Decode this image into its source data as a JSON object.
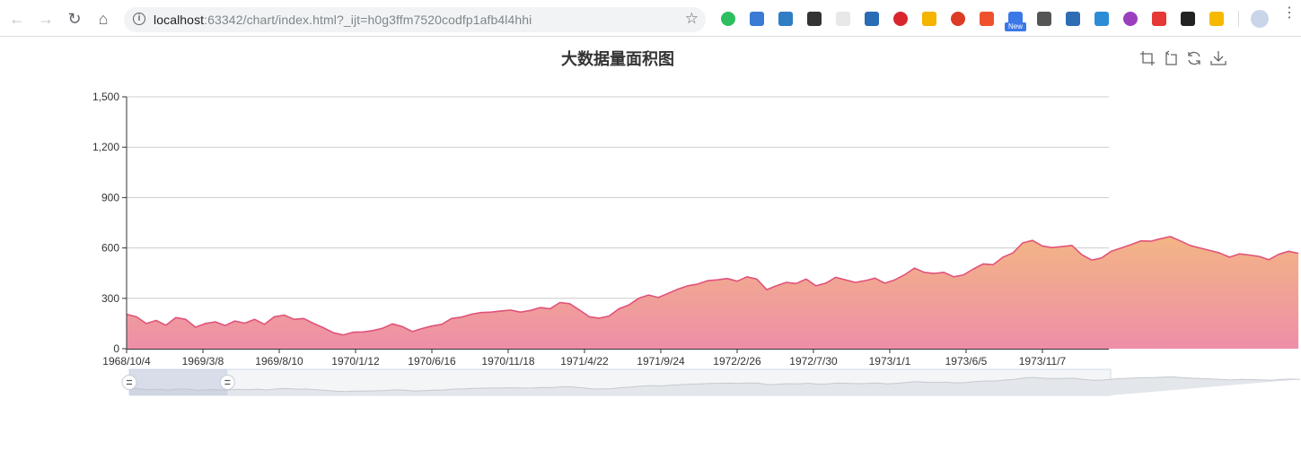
{
  "browser": {
    "url_host": "localhost",
    "url_rest": ":63342/chart/index.html?_ijt=h0g3ffm7520codfp1afb4l4hhi",
    "new_badge": "New"
  },
  "chart_data": {
    "type": "area",
    "title": "大数据量面积图",
    "x_tick_labels": [
      "1968/10/4",
      "1969/3/8",
      "1969/8/10",
      "1970/1/12",
      "1970/6/16",
      "1970/11/18",
      "1971/4/22",
      "1971/9/24",
      "1972/2/26",
      "1972/7/30",
      "1973/1/1",
      "1973/6/5",
      "1973/11/7"
    ],
    "y_tick_labels": [
      "0",
      "300",
      "600",
      "900",
      "1,200",
      "1,500"
    ],
    "ylim": [
      0,
      1500
    ],
    "xlim": [
      "1968/10/4",
      "1974/3/22"
    ],
    "grid": true,
    "series": [
      {
        "points": [
          [
            "1968/10/4",
            205
          ],
          [
            "1968/10/24",
            190
          ],
          [
            "1968/11/13",
            150
          ],
          [
            "1968/12/3",
            168
          ],
          [
            "1968/12/23",
            140
          ],
          [
            "1969/1/12",
            185
          ],
          [
            "1969/2/1",
            175
          ],
          [
            "1969/2/21",
            128
          ],
          [
            "1969/3/13",
            150
          ],
          [
            "1969/4/2",
            160
          ],
          [
            "1969/4/22",
            138
          ],
          [
            "1969/5/12",
            165
          ],
          [
            "1969/6/1",
            152
          ],
          [
            "1969/6/21",
            175
          ],
          [
            "1969/7/11",
            145
          ],
          [
            "1969/7/31",
            190
          ],
          [
            "1969/8/20",
            200
          ],
          [
            "1969/9/9",
            175
          ],
          [
            "1969/9/29",
            180
          ],
          [
            "1969/10/19",
            150
          ],
          [
            "1969/11/8",
            125
          ],
          [
            "1969/11/28",
            95
          ],
          [
            "1969/12/18",
            82
          ],
          [
            "1970/1/7",
            98
          ],
          [
            "1970/1/27",
            100
          ],
          [
            "1970/2/16",
            108
          ],
          [
            "1970/3/8",
            122
          ],
          [
            "1970/3/28",
            148
          ],
          [
            "1970/4/17",
            132
          ],
          [
            "1970/5/7",
            102
          ],
          [
            "1970/5/27",
            120
          ],
          [
            "1970/6/16",
            135
          ],
          [
            "1970/7/6",
            145
          ],
          [
            "1970/7/26",
            180
          ],
          [
            "1970/8/15",
            188
          ],
          [
            "1970/9/4",
            205
          ],
          [
            "1970/9/24",
            215
          ],
          [
            "1970/10/14",
            218
          ],
          [
            "1970/11/3",
            225
          ],
          [
            "1970/11/23",
            230
          ],
          [
            "1970/12/13",
            218
          ],
          [
            "1971/1/2",
            228
          ],
          [
            "1971/1/22",
            245
          ],
          [
            "1971/2/11",
            238
          ],
          [
            "1971/3/3",
            275
          ],
          [
            "1971/3/23",
            268
          ],
          [
            "1971/4/12",
            230
          ],
          [
            "1971/5/2",
            190
          ],
          [
            "1971/5/22",
            182
          ],
          [
            "1971/6/11",
            195
          ],
          [
            "1971/7/1",
            238
          ],
          [
            "1971/7/21",
            260
          ],
          [
            "1971/8/10",
            300
          ],
          [
            "1971/8/30",
            320
          ],
          [
            "1971/9/19",
            305
          ],
          [
            "1971/10/9",
            330
          ],
          [
            "1971/10/29",
            355
          ],
          [
            "1971/11/18",
            375
          ],
          [
            "1971/12/8",
            385
          ],
          [
            "1971/12/28",
            405
          ],
          [
            "1972/1/17",
            410
          ],
          [
            "1972/2/6",
            418
          ],
          [
            "1972/2/26",
            402
          ],
          [
            "1972/3/17",
            428
          ],
          [
            "1972/4/6",
            415
          ],
          [
            "1972/4/26",
            352
          ],
          [
            "1972/5/16",
            375
          ],
          [
            "1972/6/5",
            395
          ],
          [
            "1972/6/25",
            388
          ],
          [
            "1972/7/15",
            415
          ],
          [
            "1972/8/4",
            375
          ],
          [
            "1972/8/24",
            390
          ],
          [
            "1972/9/13",
            425
          ],
          [
            "1972/10/3",
            410
          ],
          [
            "1972/10/23",
            395
          ],
          [
            "1972/11/12",
            405
          ],
          [
            "1972/12/2",
            420
          ],
          [
            "1972/12/22",
            390
          ],
          [
            "1973/1/11",
            410
          ],
          [
            "1973/1/31",
            440
          ],
          [
            "1973/2/20",
            480
          ],
          [
            "1973/3/12",
            455
          ],
          [
            "1973/4/1",
            448
          ],
          [
            "1973/4/21",
            455
          ],
          [
            "1973/5/11",
            428
          ],
          [
            "1973/5/31",
            440
          ],
          [
            "1973/6/20",
            475
          ],
          [
            "1973/7/10",
            505
          ],
          [
            "1973/7/30",
            500
          ],
          [
            "1973/8/19",
            545
          ],
          [
            "1973/9/8",
            570
          ],
          [
            "1973/9/28",
            630
          ],
          [
            "1973/10/18",
            645
          ],
          [
            "1973/11/7",
            612
          ],
          [
            "1973/11/27",
            602
          ],
          [
            "1973/12/17",
            608
          ],
          [
            "1974/1/6",
            615
          ],
          [
            "1974/1/26",
            560
          ],
          [
            "1974/2/15",
            528
          ],
          [
            "1974/3/7",
            540
          ],
          [
            "1974/3/27",
            580
          ],
          [
            "1974/4/16",
            600
          ],
          [
            "1974/5/6",
            620
          ],
          [
            "1974/5/26",
            642
          ],
          [
            "1974/6/15",
            640
          ],
          [
            "1974/7/5",
            655
          ],
          [
            "1974/7/25",
            668
          ],
          [
            "1974/8/14",
            642
          ],
          [
            "1974/9/3",
            615
          ],
          [
            "1974/9/23",
            600
          ],
          [
            "1974/10/13",
            585
          ],
          [
            "1974/11/2",
            570
          ],
          [
            "1974/11/22",
            545
          ],
          [
            "1974/12/12",
            565
          ],
          [
            "1975/1/1",
            558
          ],
          [
            "1975/1/21",
            550
          ],
          [
            "1975/2/10",
            530
          ],
          [
            "1975/3/2",
            562
          ],
          [
            "1975/3/22",
            580
          ],
          [
            "1975/4/11",
            568
          ]
        ]
      }
    ],
    "series_line_color": "#e0537a",
    "area_gradient": [
      "#f3b585",
      "#ee8ea8"
    ],
    "datazoom_range_percent": [
      0,
      10
    ]
  }
}
